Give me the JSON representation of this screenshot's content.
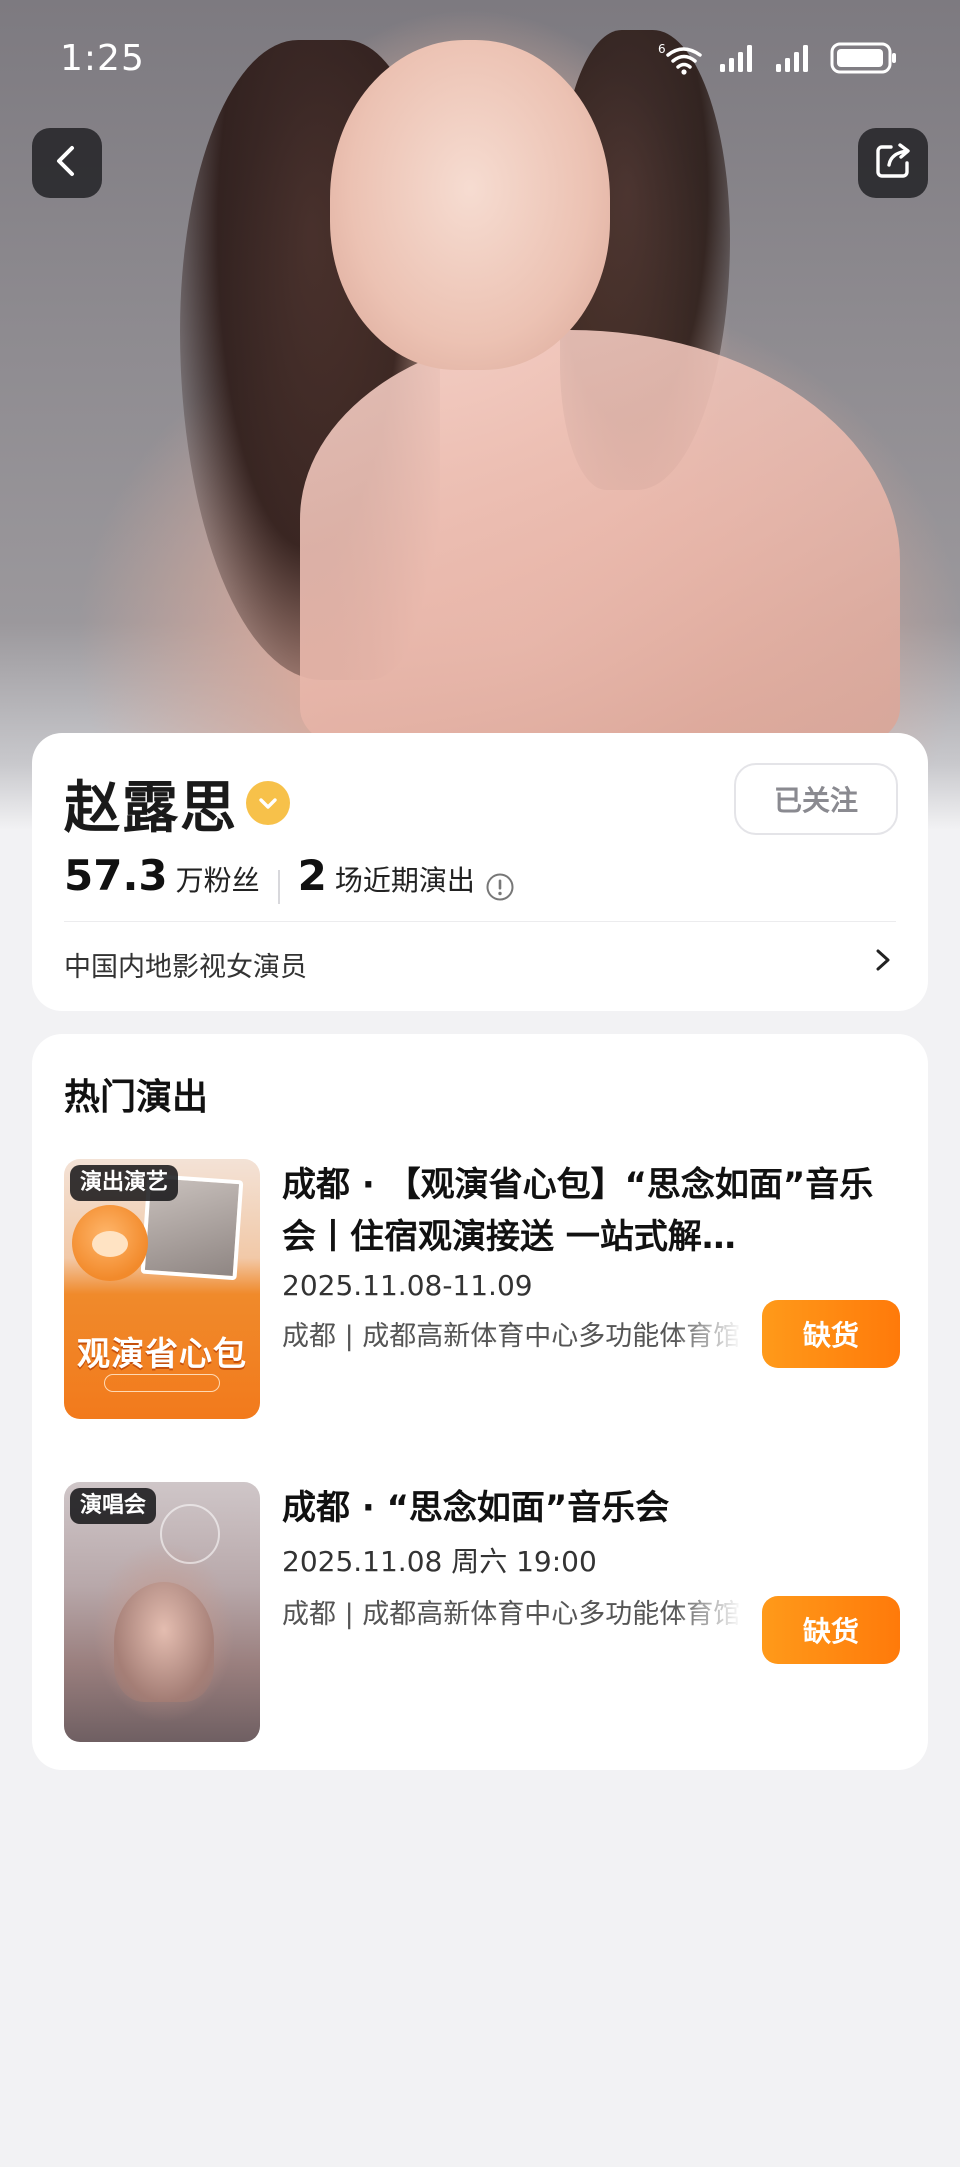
{
  "status_bar": {
    "time": "1:25",
    "wifi_label": "6",
    "battery_level": 0.85
  },
  "profile": {
    "name": "赵露思",
    "follow_label": "已关注",
    "fans_count": "57.3",
    "fans_unit": "万粉丝",
    "shows_count": "2",
    "shows_unit": "场近期演出",
    "description": "中国内地影视女演员"
  },
  "hot_shows": {
    "title": "热门演出",
    "items": [
      {
        "tag": "演出演艺",
        "poster_title": "观演省心包",
        "title": "成都 · 【观演省心包】“思念如面”音乐会丨住宿观演接送 一站式解…",
        "date": "2025.11.08-11.09",
        "venue": "成都 | 成都高新体育中心多功能体育馆",
        "status": "缺货"
      },
      {
        "tag": "演唱会",
        "title": "成都 · “思念如面”音乐会",
        "date": "2025.11.08 周六 19:00",
        "venue": "成都 | 成都高新体育中心多功能体育馆",
        "status": "缺货"
      }
    ]
  },
  "colors": {
    "accent_orange": "#ff8a12",
    "verified_gold": "#f7c14a",
    "card_bg": "#ffffff",
    "page_bg": "#f2f2f4"
  },
  "icons": {
    "back": "chevron-left-icon",
    "share": "share-icon",
    "verified": "verified-badge-icon",
    "info": "info-icon",
    "arrow": "chevron-right-icon"
  }
}
